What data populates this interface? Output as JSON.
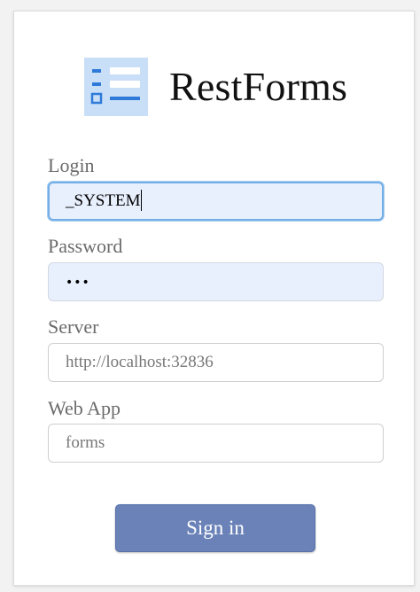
{
  "app": {
    "brand": "RestForms",
    "logo_icon": "form-list-icon",
    "colors": {
      "accent": "#6a82b8",
      "logo_bg": "#c9dff7",
      "logo_fg": "#2f7ad9",
      "focus_ring": "#74aee6",
      "autofill_bg": "#e8f0fe"
    }
  },
  "form": {
    "login": {
      "label": "Login",
      "value": "_SYSTEM"
    },
    "password": {
      "label": "Password",
      "value": "•••"
    },
    "server": {
      "label": "Server",
      "value": "http://localhost:32836"
    },
    "webapp": {
      "label": "Web App",
      "value": "forms"
    },
    "submit_label": "Sign in"
  }
}
